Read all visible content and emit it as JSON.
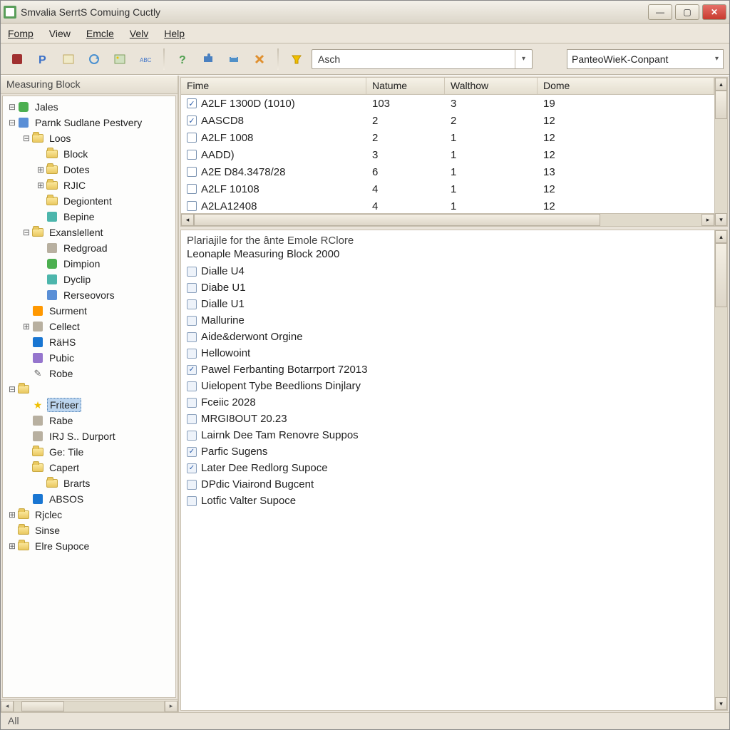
{
  "window": {
    "title": "Smvalia SerrtS Comuing Cuctly"
  },
  "menu": {
    "items": [
      "Fomp",
      "View",
      "Emcle",
      "Velv",
      "Help"
    ]
  },
  "toolbar": {
    "search_value": "Asch",
    "combo_value": "PanteoWieK-Conpant"
  },
  "sidebar": {
    "header": "Measuring Block",
    "nodes": [
      {
        "depth": 0,
        "exp": "-",
        "icon": "green",
        "label": "Jales"
      },
      {
        "depth": 0,
        "exp": "-",
        "icon": "blue",
        "label": "Parnk Sudlane Pestvery"
      },
      {
        "depth": 1,
        "exp": "-",
        "icon": "folder",
        "label": "Loos"
      },
      {
        "depth": 2,
        "exp": "",
        "icon": "folder",
        "label": "Block"
      },
      {
        "depth": 2,
        "exp": "+",
        "icon": "folder",
        "label": "Dotes"
      },
      {
        "depth": 2,
        "exp": "+",
        "icon": "folder",
        "label": "RJIC"
      },
      {
        "depth": 2,
        "exp": "",
        "icon": "folder",
        "label": "Degiontent"
      },
      {
        "depth": 2,
        "exp": "",
        "icon": "teal",
        "label": "Bepine"
      },
      {
        "depth": 1,
        "exp": "-",
        "icon": "folder",
        "label": "Exanslellent"
      },
      {
        "depth": 2,
        "exp": "",
        "icon": "gray",
        "label": "Redgroad"
      },
      {
        "depth": 2,
        "exp": "",
        "icon": "green",
        "label": "Dimpion"
      },
      {
        "depth": 2,
        "exp": "",
        "icon": "teal",
        "label": "Dyclip"
      },
      {
        "depth": 2,
        "exp": "",
        "icon": "blue",
        "label": "Rerseovors"
      },
      {
        "depth": 1,
        "exp": "",
        "icon": "orange",
        "label": "Surment"
      },
      {
        "depth": 1,
        "exp": "+",
        "icon": "gray",
        "label": "Cellect"
      },
      {
        "depth": 1,
        "exp": "",
        "icon": "dblue",
        "label": "RäHS"
      },
      {
        "depth": 1,
        "exp": "",
        "icon": "purple",
        "label": "Pubic"
      },
      {
        "depth": 1,
        "exp": "",
        "icon": "pencil",
        "label": "Robe"
      },
      {
        "depth": 0,
        "exp": "-",
        "icon": "folder",
        "label": ""
      },
      {
        "depth": 1,
        "exp": "",
        "icon": "star",
        "label": "Friteer",
        "selected": true
      },
      {
        "depth": 1,
        "exp": "",
        "icon": "gray",
        "label": "Rabe"
      },
      {
        "depth": 1,
        "exp": "",
        "icon": "gray",
        "label": "IRJ S.. Durport"
      },
      {
        "depth": 1,
        "exp": "",
        "icon": "folder",
        "label": "Ge: Tile"
      },
      {
        "depth": 1,
        "exp": "",
        "icon": "folder",
        "label": "Capert"
      },
      {
        "depth": 2,
        "exp": "",
        "icon": "folder",
        "label": "Brarts"
      },
      {
        "depth": 1,
        "exp": "",
        "icon": "dblue",
        "label": "ABSOS"
      },
      {
        "depth": 0,
        "exp": "+",
        "icon": "folder",
        "label": "Rjclec"
      },
      {
        "depth": 0,
        "exp": "",
        "icon": "folder",
        "label": "Sinse"
      },
      {
        "depth": 0,
        "exp": "+",
        "icon": "folder",
        "label": "Elre Supoce"
      }
    ]
  },
  "grid": {
    "columns": [
      "Fime",
      "Natume",
      "Walthow",
      "Dome"
    ],
    "rows": [
      {
        "chk": "✓",
        "name": "A2LF 1300D (1010)",
        "c1": "103",
        "c2": "3",
        "c3": "19"
      },
      {
        "chk": "✓",
        "name": "AASCD8",
        "c1": "2",
        "c2": "2",
        "c3": "12"
      },
      {
        "chk": "",
        "name": "A2LF 1008",
        "c1": "2",
        "c2": "1",
        "c3": "12"
      },
      {
        "chk": "",
        "name": "AADD)",
        "c1": "3",
        "c2": "1",
        "c3": "12"
      },
      {
        "chk": "",
        "name": "A2E D84.3478/28",
        "c1": "6",
        "c2": "1",
        "c3": "13"
      },
      {
        "chk": "",
        "name": "A2LF 10108",
        "c1": "4",
        "c2": "1",
        "c3": "12"
      },
      {
        "chk": "",
        "name": "A2LA12408",
        "c1": "4",
        "c2": "1",
        "c3": "12"
      }
    ]
  },
  "detail": {
    "header1": "Plariajile for the ânte Emole RClore",
    "header2": "Leonaple Measuring Block 2000",
    "items": [
      {
        "chk": "",
        "label": "Dialle U4"
      },
      {
        "chk": "",
        "label": "Diabe U1"
      },
      {
        "chk": "",
        "label": "Dialle U1"
      },
      {
        "chk": "",
        "label": "Mallurine"
      },
      {
        "chk": "",
        "label": "Aide&derwont Orgine"
      },
      {
        "chk": "",
        "label": "Hellowoint"
      },
      {
        "chk": "✓",
        "label": "Pawel Ferbanting Botarrport 72013"
      },
      {
        "chk": "",
        "label": "Uielopent Tybe Beedlions Dinjlary"
      },
      {
        "chk": "",
        "label": "Fceiic 2028"
      },
      {
        "chk": "",
        "label": "MRGI8OUT 20.23"
      },
      {
        "chk": "",
        "label": "Lairnk Dee Tam Renovre Suppos"
      },
      {
        "chk": "✓",
        "label": "Parfic Sugens"
      },
      {
        "chk": "✓",
        "label": "Later Dee Redlorg Supoce"
      },
      {
        "chk": "",
        "label": "DPdic Viairond Bugcent"
      },
      {
        "chk": "",
        "label": "Lotfic Valter Supoce"
      }
    ]
  },
  "status": {
    "text": "All"
  }
}
